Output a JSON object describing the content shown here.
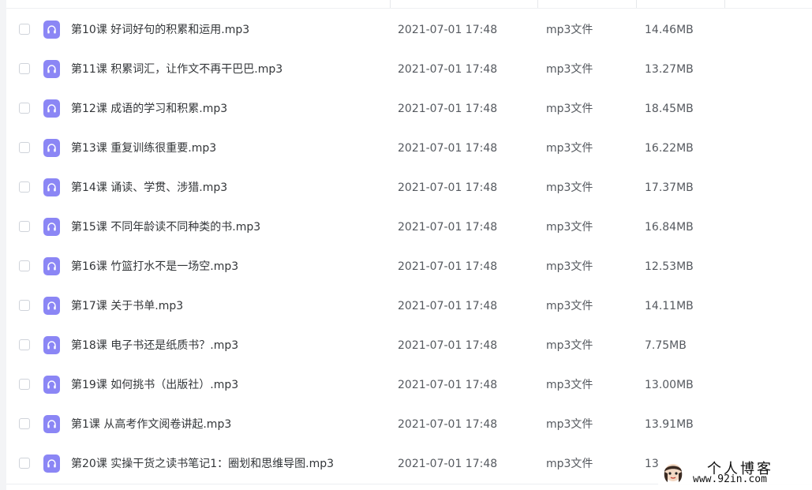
{
  "file_list": {
    "rows": [
      {
        "name": "第10课 好词好句的积累和运用.mp3",
        "date": "2021-07-01 17:48",
        "type": "mp3文件",
        "size": "14.46MB"
      },
      {
        "name": "第11课 积累词汇，让作文不再干巴巴.mp3",
        "date": "2021-07-01 17:48",
        "type": "mp3文件",
        "size": "13.27MB"
      },
      {
        "name": "第12课 成语的学习和积累.mp3",
        "date": "2021-07-01 17:48",
        "type": "mp3文件",
        "size": "18.45MB"
      },
      {
        "name": "第13课 重复训练很重要.mp3",
        "date": "2021-07-01 17:48",
        "type": "mp3文件",
        "size": "16.22MB"
      },
      {
        "name": "第14课 诵读、学贯、涉猎.mp3",
        "date": "2021-07-01 17:48",
        "type": "mp3文件",
        "size": "17.37MB"
      },
      {
        "name": "第15课 不同年龄读不同种类的书.mp3",
        "date": "2021-07-01 17:48",
        "type": "mp3文件",
        "size": "16.84MB"
      },
      {
        "name": "第16课 竹篮打水不是一场空.mp3",
        "date": "2021-07-01 17:48",
        "type": "mp3文件",
        "size": "12.53MB"
      },
      {
        "name": "第17课 关于书单.mp3",
        "date": "2021-07-01 17:48",
        "type": "mp3文件",
        "size": "14.11MB"
      },
      {
        "name": "第18课 电子书还是纸质书？.mp3",
        "date": "2021-07-01 17:48",
        "type": "mp3文件",
        "size": "7.75MB"
      },
      {
        "name": "第19课 如何挑书（出版社）.mp3",
        "date": "2021-07-01 17:48",
        "type": "mp3文件",
        "size": "13.00MB"
      },
      {
        "name": "第1课 从高考作文阅卷讲起.mp3",
        "date": "2021-07-01 17:48",
        "type": "mp3文件",
        "size": "13.91MB"
      },
      {
        "name": "第20课 实操干货之读书笔记1：圈划和思维导图.mp3",
        "date": "2021-07-01 17:48",
        "type": "mp3文件",
        "size": "13"
      }
    ]
  },
  "watermark": {
    "title": "个人博客",
    "url": "www.92in.com"
  },
  "icons": {
    "file_icon": "headphones-icon",
    "watermark_avatar": "avatar-icon"
  },
  "colors": {
    "file_icon_bg": "#8b86f5",
    "text_primary": "#333639",
    "text_secondary": "#55595f"
  }
}
